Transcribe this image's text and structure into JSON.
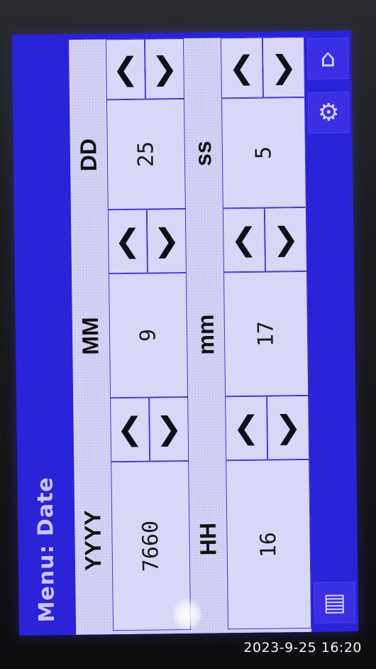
{
  "title": "Menu: Date",
  "fields": [
    {
      "label": "YYYY",
      "value": "7660"
    },
    {
      "label": "MM",
      "value": "9"
    },
    {
      "label": "DD",
      "value": "25"
    },
    {
      "label": "HH",
      "value": "16"
    },
    {
      "label": "mm",
      "value": "17"
    },
    {
      "label": "ss",
      "value": "5"
    }
  ],
  "controls": {
    "decrement": "❮",
    "increment": "❯"
  },
  "sidebar": {
    "home_icon": "home-icon",
    "settings_icon": "gear-icon",
    "page_icon": "page-icon"
  },
  "timestamp": "2023-9-25  16:20",
  "colors": {
    "accent": "#2a23d8",
    "panel": "#d6d4f6",
    "text": "#111111"
  }
}
